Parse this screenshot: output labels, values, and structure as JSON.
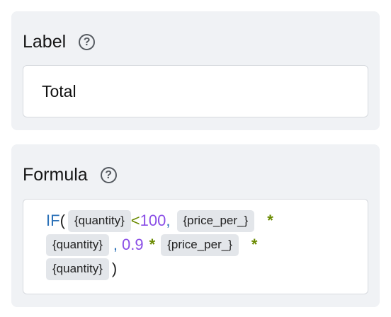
{
  "label_section": {
    "heading": "Label",
    "help_icon_glyph": "?",
    "input_value": "Total"
  },
  "formula_section": {
    "heading": "Formula",
    "help_icon_glyph": "?",
    "tokens": {
      "fn_if": "IF",
      "open_paren": "(",
      "var_quantity_1": "{quantity}",
      "lt": "<",
      "num_100": "100",
      "comma_1": ",",
      "var_price_1": "{price_per_}",
      "times_1": "*",
      "var_quantity_2": "{quantity}",
      "comma_2": ",",
      "num_09": "0.9",
      "times_2": "*",
      "var_price_2": "{price_per_}",
      "times_3": "*",
      "var_quantity_3": "{quantity}",
      "close_paren": ")"
    }
  },
  "colors": {
    "panel_bg": "#f0f2f5",
    "function": "#2b71b8",
    "number": "#8a4ee6",
    "operator": "#6a8a00",
    "chip_bg": "#e3e6ea"
  }
}
